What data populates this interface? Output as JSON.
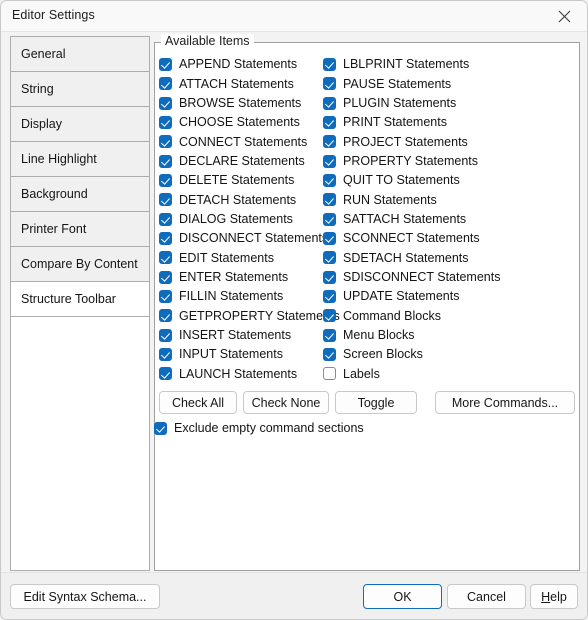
{
  "window": {
    "title": "Editor Settings",
    "close_icon": "close-icon"
  },
  "sidebar": {
    "items": [
      {
        "label": "General",
        "selected": false
      },
      {
        "label": "String",
        "selected": false
      },
      {
        "label": "Display",
        "selected": false
      },
      {
        "label": "Line Highlight",
        "selected": false
      },
      {
        "label": "Background",
        "selected": false
      },
      {
        "label": "Printer Font",
        "selected": false
      },
      {
        "label": "Compare By Content",
        "selected": false
      },
      {
        "label": "Structure Toolbar",
        "selected": true
      }
    ]
  },
  "group": {
    "legend": "Available Items",
    "left_column": [
      {
        "label": "APPEND Statements",
        "checked": true
      },
      {
        "label": "ATTACH Statements",
        "checked": true
      },
      {
        "label": "BROWSE Statements",
        "checked": true
      },
      {
        "label": "CHOOSE Statements",
        "checked": true
      },
      {
        "label": "CONNECT Statements",
        "checked": true
      },
      {
        "label": "DECLARE Statements",
        "checked": true
      },
      {
        "label": "DELETE Statements",
        "checked": true
      },
      {
        "label": "DETACH Statements",
        "checked": true
      },
      {
        "label": "DIALOG Statements",
        "checked": true
      },
      {
        "label": "DISCONNECT Statements",
        "checked": true
      },
      {
        "label": "EDIT Statements",
        "checked": true
      },
      {
        "label": "ENTER Statements",
        "checked": true
      },
      {
        "label": "FILLIN Statements",
        "checked": true
      },
      {
        "label": "GETPROPERTY Statements",
        "checked": true
      },
      {
        "label": "INSERT Statements",
        "checked": true
      },
      {
        "label": "INPUT Statements",
        "checked": true
      },
      {
        "label": "LAUNCH Statements",
        "checked": true
      }
    ],
    "right_column": [
      {
        "label": "LBLPRINT Statements",
        "checked": true
      },
      {
        "label": "PAUSE Statements",
        "checked": true
      },
      {
        "label": "PLUGIN Statements",
        "checked": true
      },
      {
        "label": "PRINT Statements",
        "checked": true
      },
      {
        "label": "PROJECT Statements",
        "checked": true
      },
      {
        "label": "PROPERTY Statements",
        "checked": true
      },
      {
        "label": "QUIT TO Statements",
        "checked": true
      },
      {
        "label": "RUN Statements",
        "checked": true
      },
      {
        "label": "SATTACH Statements",
        "checked": true
      },
      {
        "label": "SCONNECT Statements",
        "checked": true
      },
      {
        "label": "SDETACH Statements",
        "checked": true
      },
      {
        "label": "SDISCONNECT Statements",
        "checked": true
      },
      {
        "label": "UPDATE Statements",
        "checked": true
      },
      {
        "label": "Command Blocks",
        "checked": true
      },
      {
        "label": "Menu Blocks",
        "checked": true
      },
      {
        "label": "Screen Blocks",
        "checked": true
      },
      {
        "label": "Labels",
        "checked": false
      }
    ],
    "buttons": {
      "check_all": "Check All",
      "check_none": "Check None",
      "toggle": "Toggle",
      "more_commands": "More Commands..."
    },
    "exclude_empty": {
      "label": "Exclude empty command sections",
      "checked": true
    }
  },
  "footer": {
    "edit_syntax": "Edit Syntax Schema...",
    "ok": "OK",
    "cancel": "Cancel",
    "help_accel": "H",
    "help_rest": "elp"
  },
  "colors": {
    "accent": "#0f6cbd",
    "window_bg": "#f3f3f3",
    "panel_bg": "#ffffff",
    "tab_bg": "#f0f0f0",
    "border": "#a0a0a0"
  }
}
